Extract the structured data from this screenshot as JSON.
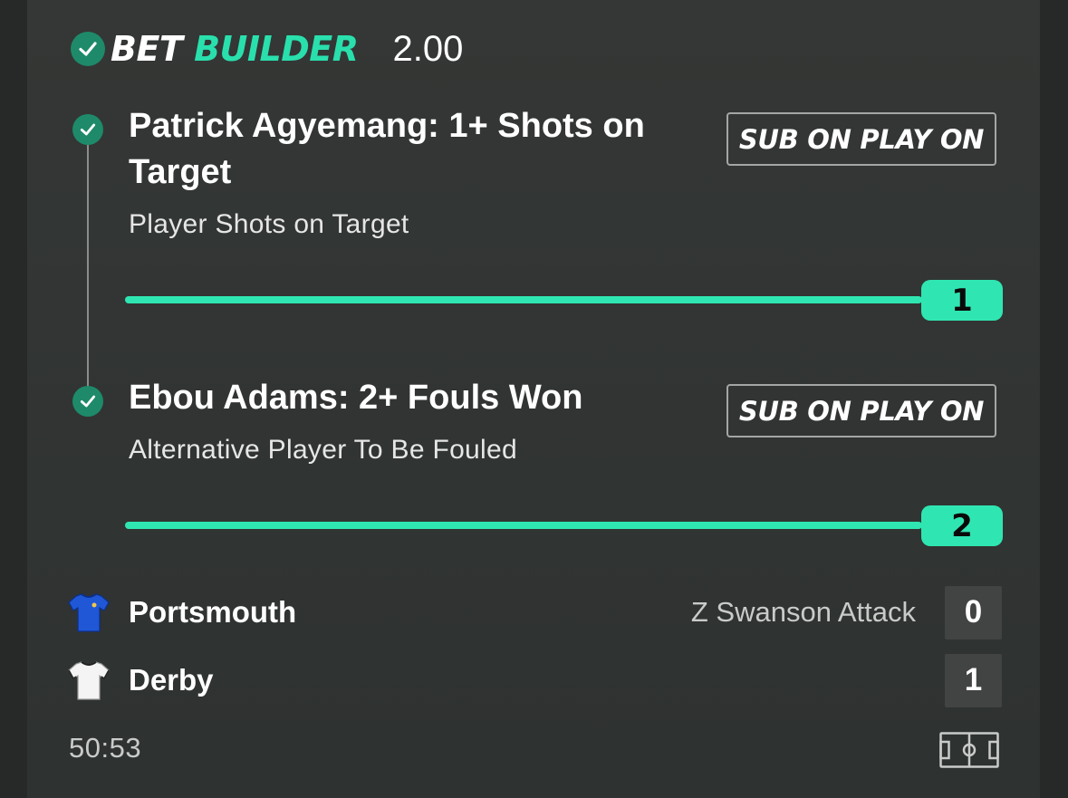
{
  "header": {
    "title_bet": "BET",
    "title_builder": "BUILDER",
    "odds": "2.00",
    "accent_color": "#29e0ad"
  },
  "selections": [
    {
      "title": "Patrick Agyemang: 1+ Shots on Target",
      "market": "Player Shots on Target",
      "button_label": "SUB ON PLAY ON",
      "progress_value": "1",
      "progress_fraction": 1.0
    },
    {
      "title": "Ebou Adams: 2+ Fouls Won",
      "market": "Alternative Player To Be Fouled",
      "button_label": "SUB ON PLAY ON",
      "progress_value": "2",
      "progress_fraction": 1.0
    }
  ],
  "match": {
    "home": {
      "name": "Portsmouth",
      "info": "Z Swanson Attack",
      "score": "0",
      "shirt_icon": "blue-shirt-icon"
    },
    "away": {
      "name": "Derby",
      "info": "",
      "score": "1",
      "shirt_icon": "white-shirt-icon"
    },
    "clock": "50:53",
    "pitch_icon": "pitch-icon"
  },
  "colors": {
    "progress": "#2fe6b2",
    "check": "#1e8a6a"
  }
}
